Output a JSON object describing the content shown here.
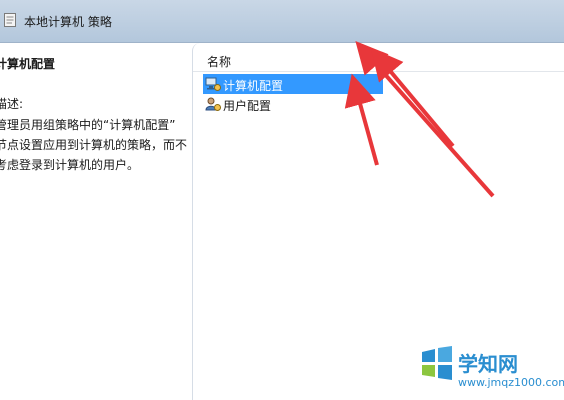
{
  "window": {
    "title": "本地计算机 策略",
    "title_icon": "policy-document-icon"
  },
  "left_pane": {
    "heading": "计算机配置",
    "description_label": "描述:",
    "description_lines": [
      "管理员用组策略中的“计算机配置”",
      "节点设置应用到计算机的策略，而不",
      "考虑登录到计算机的用户。"
    ]
  },
  "list": {
    "column_header": "名称",
    "items": [
      {
        "label": "计算机配置",
        "icon": "computer-config-icon",
        "selected": true
      },
      {
        "label": "用户配置",
        "icon": "user-config-icon",
        "selected": false
      }
    ]
  },
  "annotation": {
    "arrow_color": "#e8373a"
  },
  "watermark": {
    "text": "学知网",
    "url": "www.jmqz1000.com",
    "logo_icon": "windows-logo-icon"
  }
}
